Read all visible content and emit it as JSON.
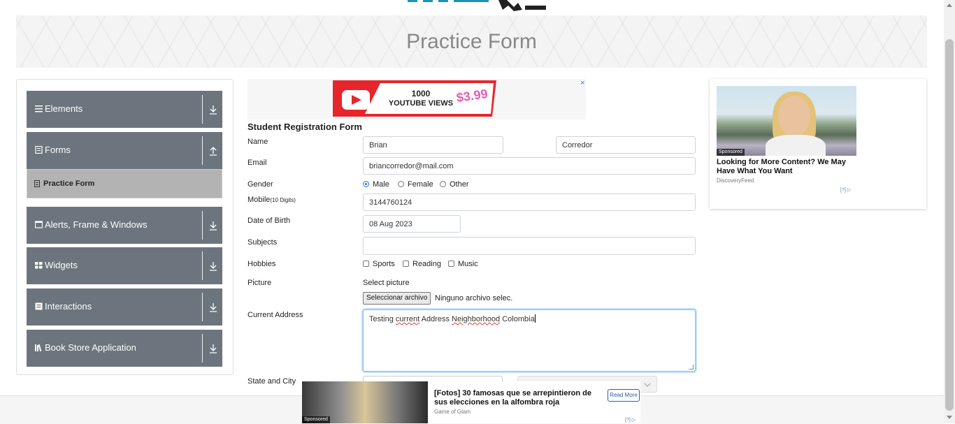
{
  "header": {
    "title": "Practice Form"
  },
  "sidebar": {
    "groups": [
      {
        "label": "Elements",
        "icon": "hamburger-icon",
        "arrow": "down"
      },
      {
        "label": "Forms",
        "icon": "document-icon",
        "arrow": "up"
      },
      {
        "label": "Alerts, Frame & Windows",
        "icon": "window-icon",
        "arrow": "down"
      },
      {
        "label": "Widgets",
        "icon": "grid-icon",
        "arrow": "down"
      },
      {
        "label": "Interactions",
        "icon": "list-icon",
        "arrow": "down"
      },
      {
        "label": "Book Store Application",
        "icon": "books-icon",
        "arrow": "down"
      }
    ],
    "active_item": {
      "label": "Practice Form",
      "icon": "file-icon"
    }
  },
  "ads": {
    "top": {
      "line1": "1000",
      "line2": "YOUTUBE VIEWS",
      "price": "$3.99",
      "close": "×"
    },
    "right": {
      "sponsored": "Sponsored",
      "title": "Looking for More Content? We May Have What You Want",
      "source": "DiscoveryFeed",
      "info": "[?]"
    },
    "bottom": {
      "sponsored": "Sponsored",
      "title": "[Fotos] 30 famosas que se arrepintieron de sus elecciones en la alfombra roja",
      "source": "Game of Glam",
      "button": "Read More",
      "info": "[?]"
    }
  },
  "form": {
    "title": "Student Registration Form",
    "name_label": "Name",
    "first_name": "Brian",
    "last_name": "Corredor",
    "email_label": "Email",
    "email": "briancorredor@mail.com",
    "gender_label": "Gender",
    "gender_options": [
      "Male",
      "Female",
      "Other"
    ],
    "gender_selected": "Male",
    "mobile_label": "Mobile",
    "mobile_hint": "(10 Digits)",
    "mobile": "3144760124",
    "dob_label": "Date of Birth",
    "dob": "08 Aug 2023",
    "subjects_label": "Subjects",
    "subjects": "",
    "hobbies_label": "Hobbies",
    "hobbies": [
      "Sports",
      "Reading",
      "Music"
    ],
    "picture_label": "Picture",
    "picture_prompt": "Select picture",
    "file_button": "Seleccionar archivo",
    "file_status": "Ninguno archivo selec.",
    "address_label": "Current Address",
    "address_words": [
      "Testing",
      "current",
      "Address",
      "Neighborhood",
      "Colombia"
    ],
    "state_city_label": "State and City"
  }
}
